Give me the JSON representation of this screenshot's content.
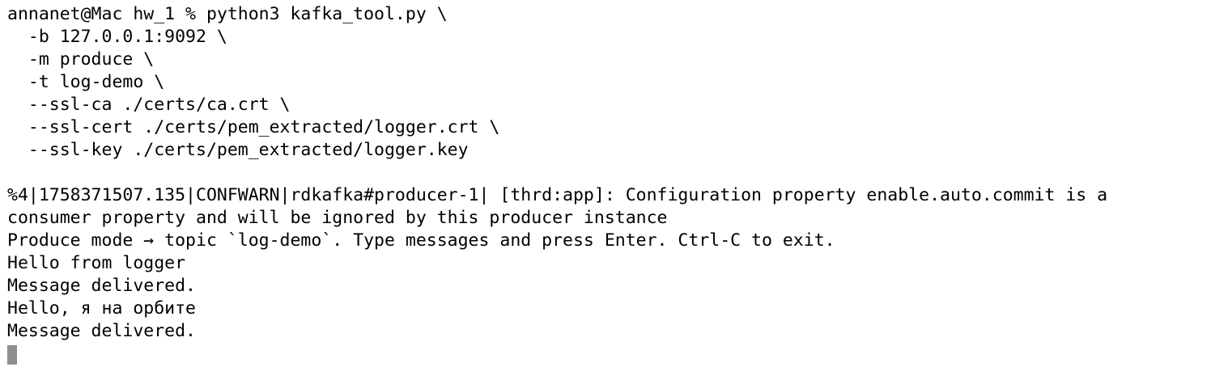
{
  "terminal": {
    "lines": [
      "annanet@Mac hw_1 % python3 kafka_tool.py \\",
      "  -b 127.0.0.1:9092 \\",
      "  -m produce \\",
      "  -t log-demo \\",
      "  --ssl-ca ./certs/ca.crt \\",
      "  --ssl-cert ./certs/pem_extracted/logger.crt \\",
      "  --ssl-key ./certs/pem_extracted/logger.key",
      "",
      "%4|1758371507.135|CONFWARN|rdkafka#producer-1| [thrd:app]: Configuration property enable.auto.commit is a",
      "consumer property and will be ignored by this producer instance",
      "Produce mode → topic `log-demo`. Type messages and press Enter. Ctrl-C to exit.",
      "Hello from logger",
      "Message delivered.",
      "Hello, я на орбите",
      "Message delivered."
    ]
  }
}
